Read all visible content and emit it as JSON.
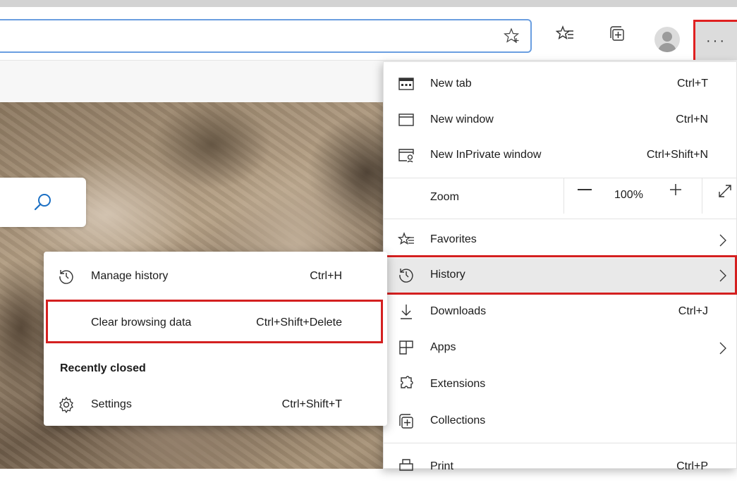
{
  "toolbar": {
    "icons": [
      "star-add-icon",
      "favorites-icon",
      "collections-icon",
      "profile-avatar-icon",
      "more-options-icon"
    ],
    "more_label": "···",
    "accent_outline": "#d42020"
  },
  "menu": {
    "new_tab": {
      "label": "New tab",
      "shortcut": "Ctrl+T"
    },
    "new_window": {
      "label": "New window",
      "shortcut": "Ctrl+N"
    },
    "new_inprivate": {
      "label": "New InPrivate window",
      "shortcut": "Ctrl+Shift+N"
    },
    "zoom": {
      "label": "Zoom",
      "value": "100%"
    },
    "favorites": {
      "label": "Favorites"
    },
    "history": {
      "label": "History"
    },
    "downloads": {
      "label": "Downloads",
      "shortcut": "Ctrl+J"
    },
    "apps": {
      "label": "Apps"
    },
    "extensions": {
      "label": "Extensions"
    },
    "collections": {
      "label": "Collections"
    },
    "print": {
      "label": "Print",
      "shortcut": "Ctrl+P"
    }
  },
  "history_submenu": {
    "manage": {
      "label": "Manage history",
      "shortcut": "Ctrl+H"
    },
    "clear": {
      "label": "Clear browsing data",
      "shortcut": "Ctrl+Shift+Delete"
    },
    "recently_closed_heading": "Recently closed",
    "recent_items": [
      {
        "label": "Settings",
        "shortcut": "Ctrl+Shift+T"
      }
    ]
  }
}
